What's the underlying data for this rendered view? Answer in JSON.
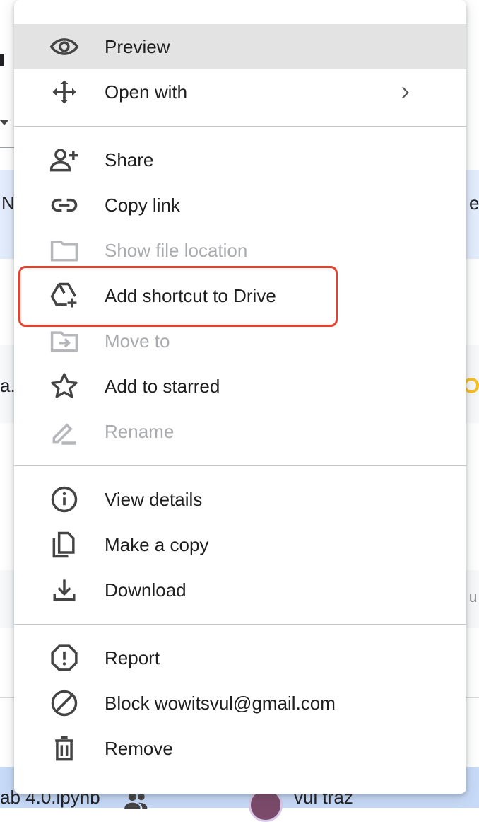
{
  "background": {
    "left_fragments": [
      "N",
      "a.."
    ],
    "right_fragments": [
      "e",
      "u"
    ],
    "bottom_file_name": "ab 4.0.ipynb",
    "bottom_owner": "vul traz"
  },
  "menu": {
    "items": [
      {
        "label": "Preview",
        "icon": "eye-icon",
        "enabled": true
      },
      {
        "label": "Open with",
        "icon": "move-arrows-icon",
        "enabled": true,
        "submenu": true
      },
      {
        "label": "Share",
        "icon": "person-add-icon",
        "enabled": true
      },
      {
        "label": "Copy link",
        "icon": "link-icon",
        "enabled": true
      },
      {
        "label": "Show file location",
        "icon": "folder-icon",
        "enabled": false
      },
      {
        "label": "Add shortcut to Drive",
        "icon": "drive-add-icon",
        "enabled": true
      },
      {
        "label": "Move to",
        "icon": "folder-move-icon",
        "enabled": false
      },
      {
        "label": "Add to starred",
        "icon": "star-icon",
        "enabled": true
      },
      {
        "label": "Rename",
        "icon": "pencil-icon",
        "enabled": false
      },
      {
        "label": "View details",
        "icon": "info-icon",
        "enabled": true
      },
      {
        "label": "Make a copy",
        "icon": "copy-icon",
        "enabled": true
      },
      {
        "label": "Download",
        "icon": "download-icon",
        "enabled": true
      },
      {
        "label": "Report",
        "icon": "report-icon",
        "enabled": true
      },
      {
        "label": "Block wowitsvul@gmail.com",
        "icon": "block-icon",
        "enabled": true
      },
      {
        "label": "Remove",
        "icon": "trash-icon",
        "enabled": true
      }
    ]
  },
  "colors": {
    "hover_bg": "#e3e3e3",
    "highlight_border": "#e2432f",
    "disabled_text": "#a9abae"
  }
}
